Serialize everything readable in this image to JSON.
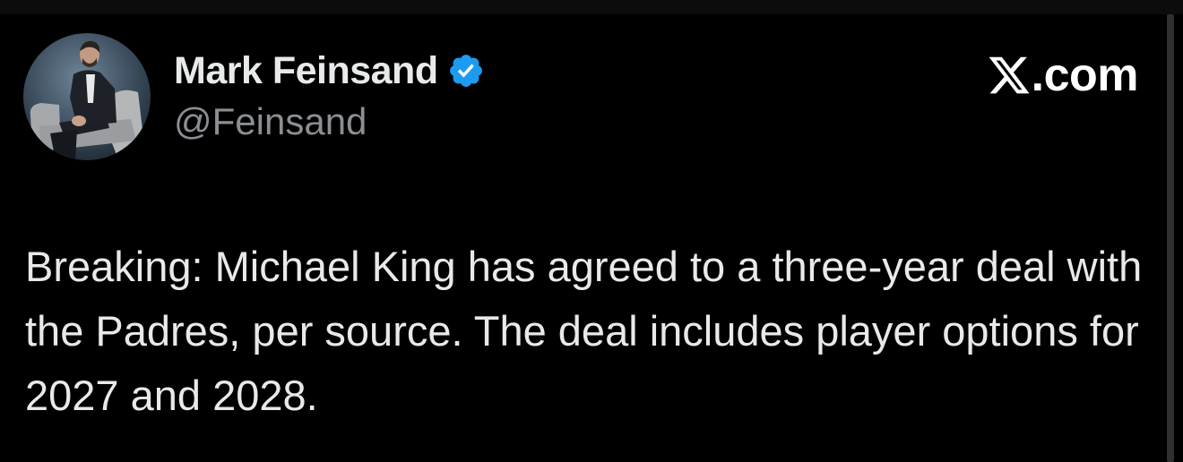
{
  "author": {
    "display_name": "Mark Feinsand",
    "handle": "@Feinsand",
    "verified": true,
    "verified_badge_color": "#1d9bf0",
    "avatar_icon": "profile-photo"
  },
  "brand": {
    "logo_icon": "x-logo-icon",
    "text": ".com"
  },
  "tweet": {
    "text": "Breaking: Michael King has agreed to a three-year deal with the Padres, per source. The deal includes player options for 2027 and 2028."
  },
  "colors": {
    "background": "#000000",
    "primary_text": "#e7e9ea",
    "secondary_text": "#8b8e92"
  }
}
